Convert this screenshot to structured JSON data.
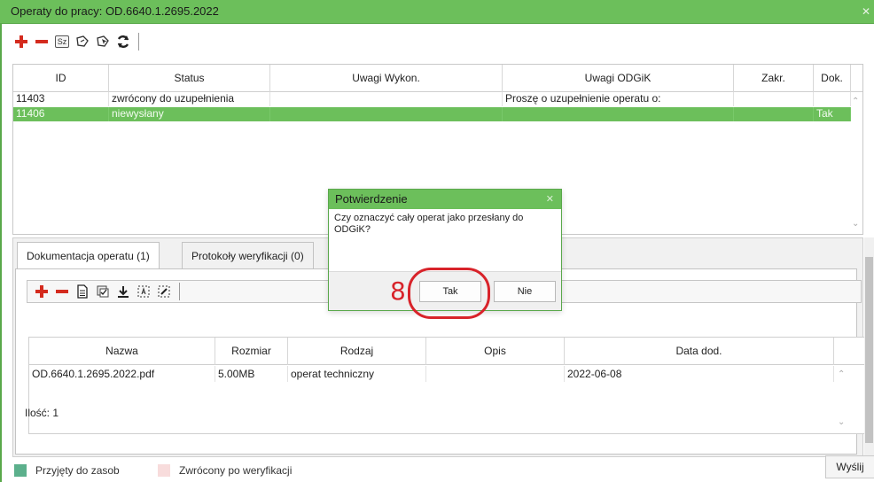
{
  "window": {
    "title": "Operaty do pracy: OD.6640.1.2695.2022",
    "close_glyph": "✕"
  },
  "toolbar": {
    "sz_label": "Sz"
  },
  "top_table": {
    "columns": [
      "ID",
      "Status",
      "Uwagi Wykon.",
      "Uwagi ODGiK",
      "Zakr.",
      "Dok."
    ],
    "rows": [
      {
        "id": "11403",
        "status": "zwrócony do uzupełnienia",
        "uwagi_wykon": "",
        "uwagi_odgik": "Proszę o uzupełnienie operatu o:",
        "zakr": "",
        "dok": ""
      },
      {
        "id": "11406",
        "status": "niewysłany",
        "uwagi_wykon": "",
        "uwagi_odgik": "",
        "zakr": "",
        "dok": "Tak"
      }
    ],
    "selected_row_index": 1
  },
  "tabs": [
    {
      "label": "Dokumentacja operatu (1)",
      "active": true
    },
    {
      "label": "Protokoły weryfikacji (0)",
      "active": false
    }
  ],
  "doc_table": {
    "columns": [
      "Nazwa",
      "Rozmiar",
      "Rodzaj",
      "Opis",
      "Data dod."
    ],
    "rows": [
      {
        "nazwa": "OD.6640.1.2695.2022.pdf",
        "rozmiar": "5.00MB",
        "rodzaj": "operat techniczny",
        "opis": "",
        "data": "2022-06-08"
      }
    ]
  },
  "count_label": "Ilość: 1",
  "legend": [
    {
      "label": "Przyjęty do zasob",
      "color": "#5cb08c"
    },
    {
      "label": "Zwrócony po weryfikacji",
      "color": "#f8dcdc"
    }
  ],
  "send_button": "Wyślij",
  "dialog": {
    "title": "Potwierdzenie",
    "close_glyph": "✕",
    "message": "Czy oznaczyć cały operat jako przesłany do ODGiK?",
    "yes_label": "Tak",
    "no_label": "Nie"
  },
  "annotation": {
    "number": "8"
  },
  "colors": {
    "accent_green": "#6cbf5b",
    "delete_red": "#d42b1e",
    "annotation_red": "#d8232a"
  }
}
